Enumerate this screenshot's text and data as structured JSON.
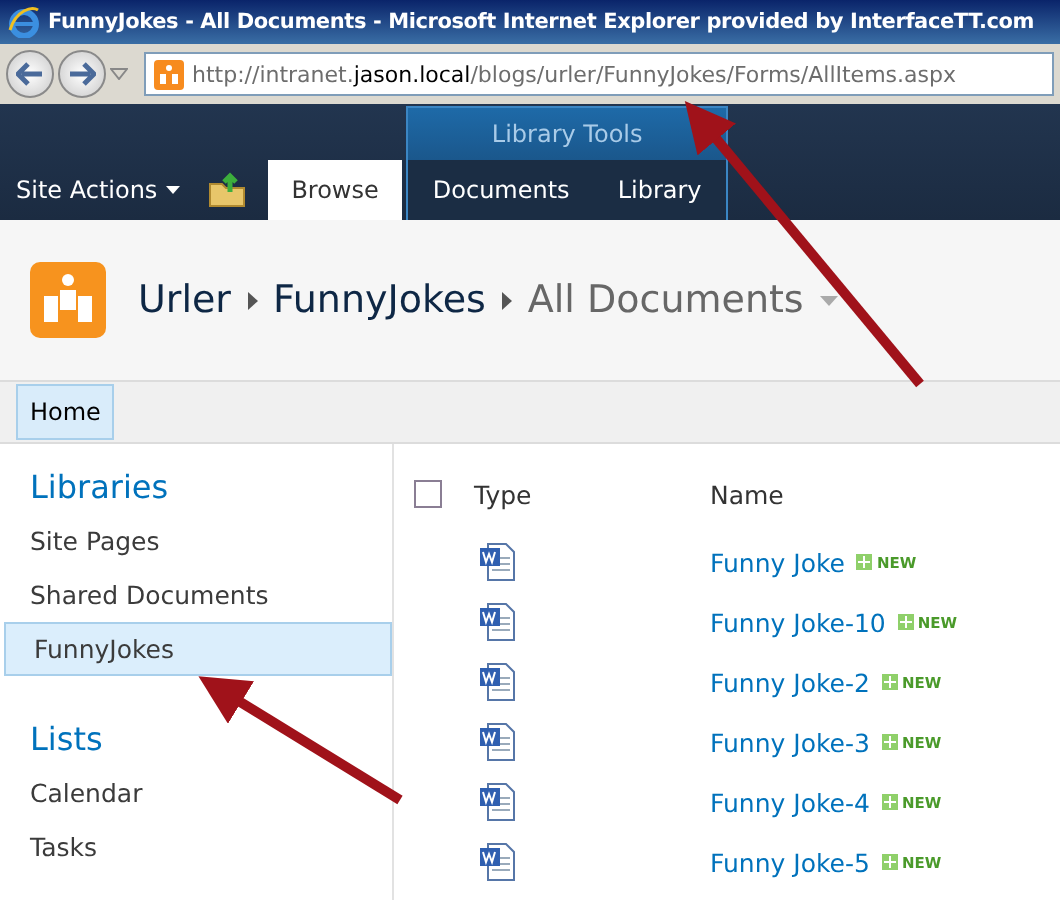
{
  "window": {
    "title": "FunnyJokes - All Documents - Microsoft Internet Explorer provided by InterfaceTT.com"
  },
  "address_bar": {
    "parts": [
      {
        "text": "http://intranet.",
        "kind": "dim"
      },
      {
        "text": "jason.local",
        "kind": "host"
      },
      {
        "text": "/blogs/urler/FunnyJokes/Forms/AllItems.aspx",
        "kind": "dim"
      }
    ]
  },
  "ribbon": {
    "site_actions": "Site Actions",
    "group_label": "Library Tools",
    "tabs": [
      {
        "label": "Browse",
        "selected": true
      },
      {
        "label": "Documents",
        "selected": false
      },
      {
        "label": "Library",
        "selected": false
      }
    ]
  },
  "breadcrumb": [
    "Urler",
    "FunnyJokes",
    "All Documents"
  ],
  "top_nav": [
    {
      "label": "Home",
      "selected": true
    }
  ],
  "sidebar": {
    "sections": [
      {
        "heading": "Libraries",
        "items": [
          {
            "label": "Site Pages",
            "selected": false
          },
          {
            "label": "Shared Documents",
            "selected": false
          },
          {
            "label": "FunnyJokes",
            "selected": true
          }
        ]
      },
      {
        "heading": "Lists",
        "items": [
          {
            "label": "Calendar",
            "selected": false
          },
          {
            "label": "Tasks",
            "selected": false
          }
        ]
      }
    ]
  },
  "table": {
    "select_all_checked": false,
    "columns": [
      "Type",
      "Name"
    ],
    "rows": [
      {
        "name": "Funny Joke",
        "badge": "NEW"
      },
      {
        "name": "Funny Joke-10",
        "badge": "NEW"
      },
      {
        "name": "Funny Joke-2",
        "badge": "NEW"
      },
      {
        "name": "Funny Joke-3",
        "badge": "NEW"
      },
      {
        "name": "Funny Joke-4",
        "badge": "NEW"
      },
      {
        "name": "Funny Joke-5",
        "badge": "NEW"
      }
    ]
  }
}
